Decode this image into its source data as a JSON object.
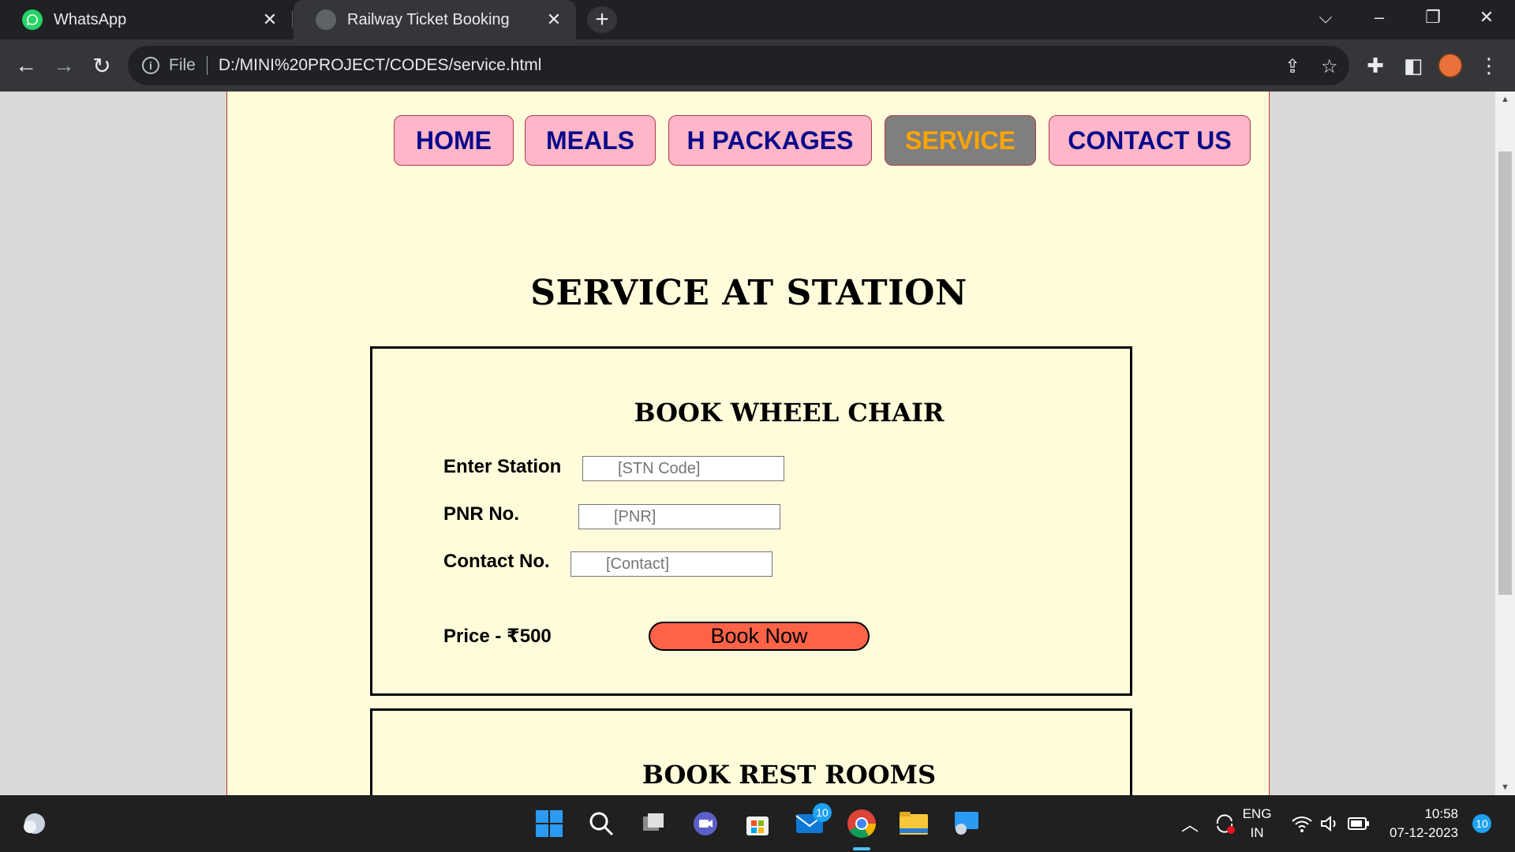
{
  "browser": {
    "tabs": [
      {
        "title": "WhatsApp",
        "icon": "whatsapp-icon",
        "active": false
      },
      {
        "title": "Railway Ticket Booking",
        "icon": "globe-icon",
        "active": true
      }
    ],
    "address": {
      "scheme_label": "File",
      "url": "D:/MINI%20PROJECT/CODES/service.html"
    }
  },
  "page": {
    "nav": [
      "HOME",
      "MEALS",
      "H PACKAGES",
      "SERVICE",
      "CONTACT US"
    ],
    "active_nav": "SERVICE",
    "title": "SERVICE AT STATION",
    "wheelchair": {
      "heading": "BOOK WHEEL CHAIR",
      "station_label": "Enter Station",
      "station_placeholder": "[STN Code]",
      "pnr_label": "PNR No.",
      "pnr_placeholder": "[PNR]",
      "contact_label": "Contact No.",
      "contact_placeholder": "[Contact]",
      "price": "Price - ₹500",
      "button": "Book Now"
    },
    "restrooms": {
      "heading": "BOOK REST ROOMS"
    }
  },
  "taskbar": {
    "language": "ENG",
    "region": "IN",
    "time": "10:58",
    "date": "07-12-2023",
    "mail_badge": "10",
    "notification_count": "10"
  },
  "colors": {
    "page_bg": "#fffcdb",
    "nav_bg": "#ffb6c8",
    "nav_text": "#0a0a8a",
    "nav_active_bg": "#7f7f7f",
    "nav_active_text": "#ffa500",
    "button_bg": "#ff6347"
  }
}
